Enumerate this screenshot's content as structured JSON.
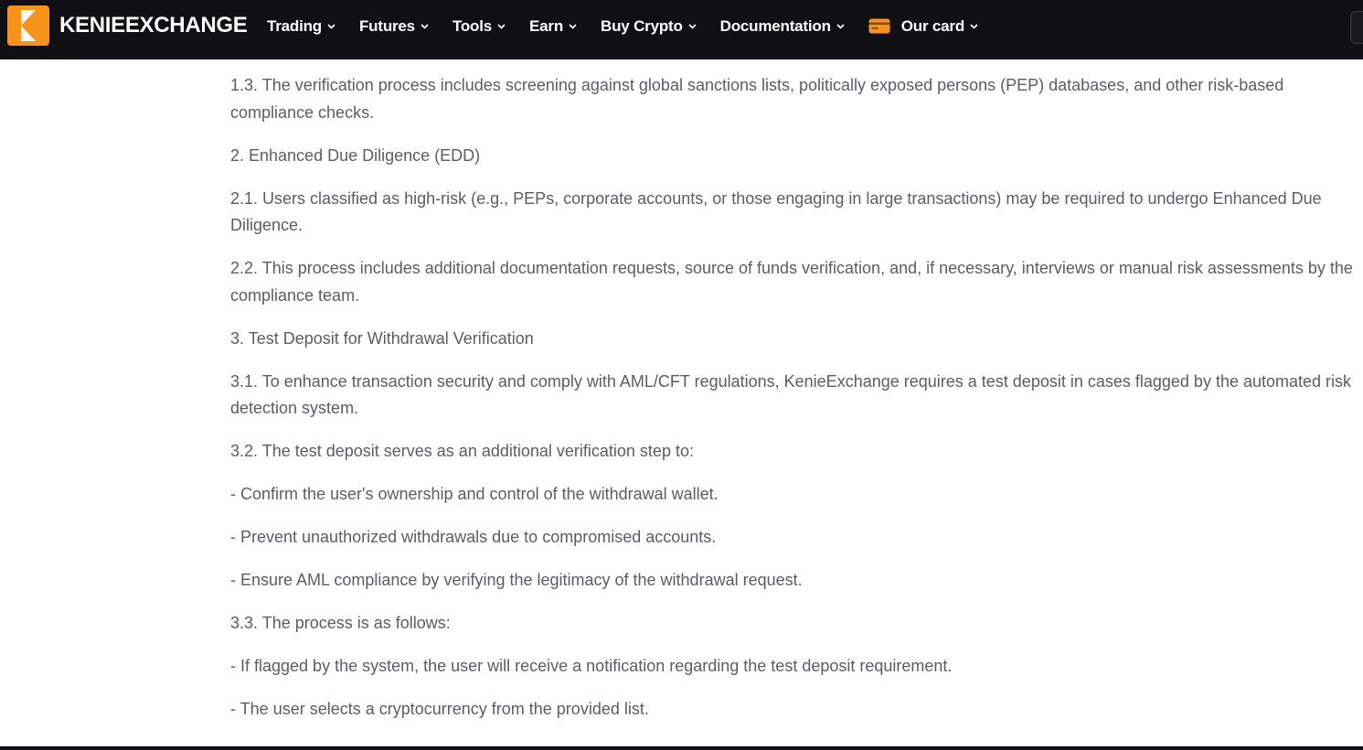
{
  "header": {
    "brand": "KENIEEXCHANGE",
    "nav": [
      {
        "label": "Trading"
      },
      {
        "label": "Futures"
      },
      {
        "label": "Tools"
      },
      {
        "label": "Earn"
      },
      {
        "label": "Buy Crypto"
      },
      {
        "label": "Documentation"
      },
      {
        "label": "Our card"
      }
    ]
  },
  "colors": {
    "header_bg": "#101014",
    "accent_orange": "#f7931a",
    "text_muted": "#5c5c66"
  },
  "content": {
    "paragraphs": [
      "1.3. The verification process includes screening against global sanctions lists, politically exposed persons (PEP) databases, and other risk-based compliance checks.",
      "2. Enhanced Due Diligence (EDD)",
      "2.1. Users classified as high-risk (e.g., PEPs, corporate accounts, or those engaging in large transactions) may be required to undergo Enhanced Due Diligence.",
      "2.2. This process includes additional documentation requests, source of funds verification, and, if necessary, interviews or manual risk assessments by the compliance team.",
      "3. Test Deposit for Withdrawal Verification",
      "3.1. To enhance transaction security and comply with AML/CFT regulations, KenieExchange requires a test deposit in cases flagged by the automated risk detection system.",
      "3.2. The test deposit serves as an additional verification step to:",
      "- Confirm the user's ownership and control of the withdrawal wallet.",
      "- Prevent unauthorized withdrawals due to compromised accounts.",
      "- Ensure AML compliance by verifying the legitimacy of the withdrawal request.",
      "3.3. The process is as follows:",
      "- If flagged by the system, the user will receive a notification regarding the test deposit requirement.",
      "- The user selects a cryptocurrency from the provided list."
    ]
  }
}
